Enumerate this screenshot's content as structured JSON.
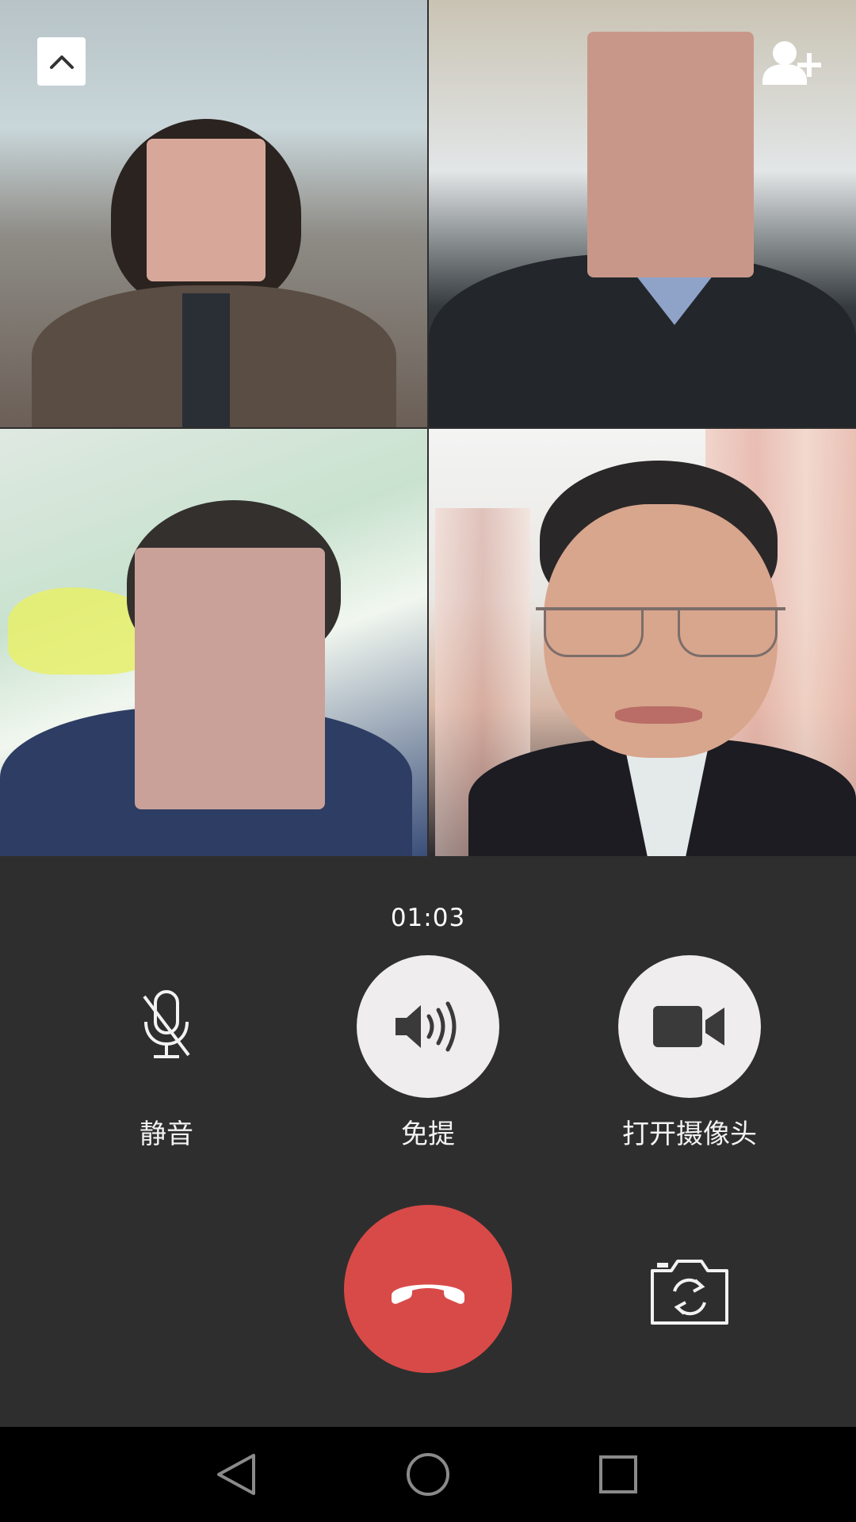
{
  "call": {
    "timer": "01:03"
  },
  "controls": {
    "mute_label": "静音",
    "speaker_label": "免提",
    "camera_label": "打开摄像头"
  },
  "participants": [
    {
      "tile": "top-left",
      "blurred": true
    },
    {
      "tile": "top-right",
      "blurred": true
    },
    {
      "tile": "bottom-left",
      "blurred": true
    },
    {
      "tile": "bottom-right",
      "blurred": false
    }
  ],
  "icons": {
    "collapse": "chevron-up-icon",
    "add_participant": "add-user-icon",
    "mute": "mic-off-icon",
    "speaker": "speaker-icon",
    "camera": "video-camera-icon",
    "hangup": "phone-hangup-icon",
    "switch_camera": "camera-switch-icon",
    "nav_back": "back-triangle-icon",
    "nav_home": "home-circle-icon",
    "nav_recent": "recent-square-icon"
  },
  "colors": {
    "panel_bg": "#2f2e2e",
    "control_circle": "#efeded",
    "hangup_red": "#d84a48",
    "text": "#ffffff"
  }
}
